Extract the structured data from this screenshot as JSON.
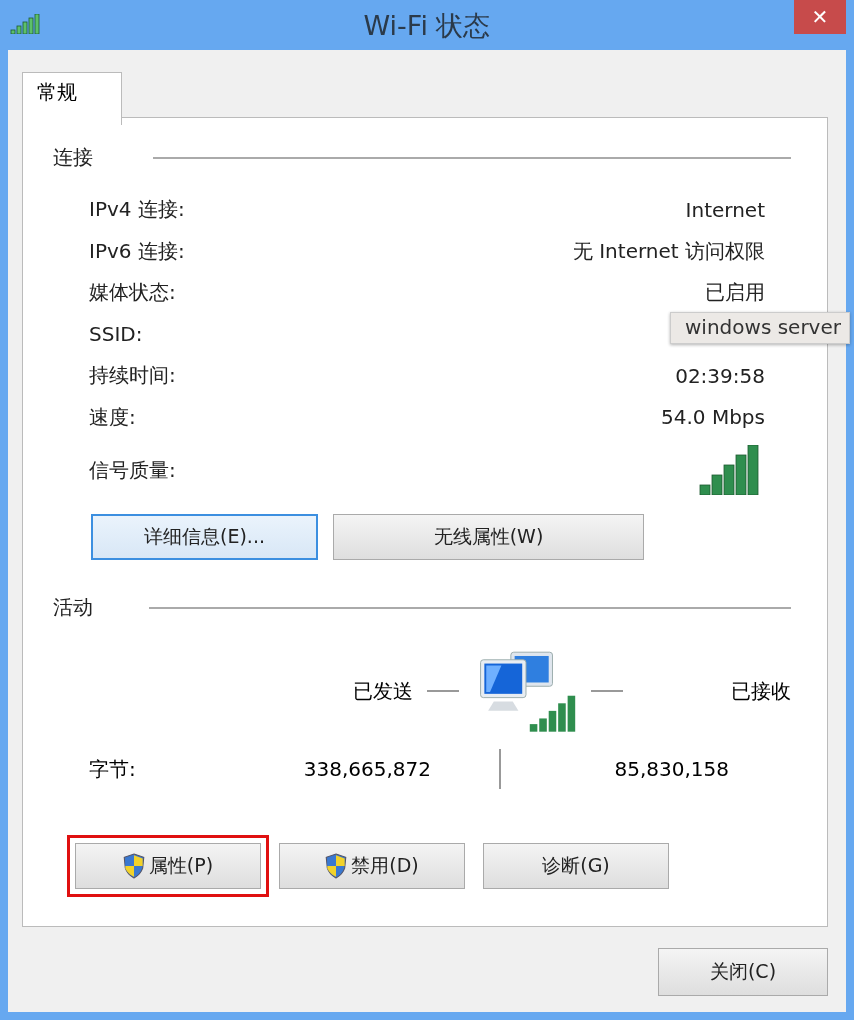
{
  "window": {
    "title": "Wi-Fi 状态",
    "close": "✕"
  },
  "tabs": [
    {
      "label": "常规",
      "selected": true
    }
  ],
  "connection": {
    "heading": "连接",
    "rows": [
      {
        "label": "IPv4 连接:",
        "value": "Internet"
      },
      {
        "label": "IPv6 连接:",
        "value": "无 Internet 访问权限"
      },
      {
        "label": "媒体状态:",
        "value": "已启用"
      },
      {
        "label": "SSID:"
      },
      {
        "label": "持续时间:",
        "value": "02:39:58"
      },
      {
        "label": "速度:",
        "value": "54.0 Mbps"
      },
      {
        "label": "信号质量:",
        "kind": "signal"
      }
    ],
    "buttons": [
      {
        "label": "详细信息(E)...",
        "focused": true
      },
      {
        "label": "无线属性(W)",
        "focused": false
      }
    ]
  },
  "activity": {
    "heading": "活动",
    "sent": "已发送",
    "received": "已接收",
    "bytes_label": "字节:",
    "bytes_sent": "338,665,872",
    "bytes_received": "85,830,158"
  },
  "action_buttons": [
    {
      "label": "属性(P)",
      "shield": true,
      "highlighted": true
    },
    {
      "label": "禁用(D)",
      "shield": true,
      "highlighted": false
    },
    {
      "label": "诊断(G)",
      "shield": false,
      "highlighted": false
    }
  ],
  "footer_buttons": [
    {
      "label": "关闭(C)"
    }
  ],
  "tooltip": {
    "text": "windows server"
  }
}
